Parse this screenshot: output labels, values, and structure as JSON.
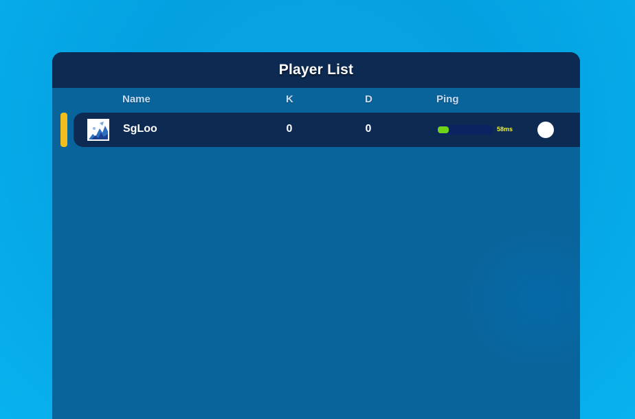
{
  "panel": {
    "title": "Player List"
  },
  "columns": {
    "name": "Name",
    "kills": "K",
    "deaths": "D",
    "ping": "Ping"
  },
  "players": [
    {
      "name": "SgLoo",
      "kills": "0",
      "deaths": "0",
      "ping_label": "58ms",
      "ping_level": 0.2,
      "avatar_icon": "player-avatar-icon",
      "status_icon": "status-dot-icon"
    }
  ],
  "colors": {
    "background": "#04a0e0",
    "panel": "#0a649c",
    "header": "#0d2a52",
    "row": "#0d2a52",
    "accent": "#f2be1e",
    "ping_good": "#6fd31a",
    "ping_text": "#f1f13b"
  }
}
